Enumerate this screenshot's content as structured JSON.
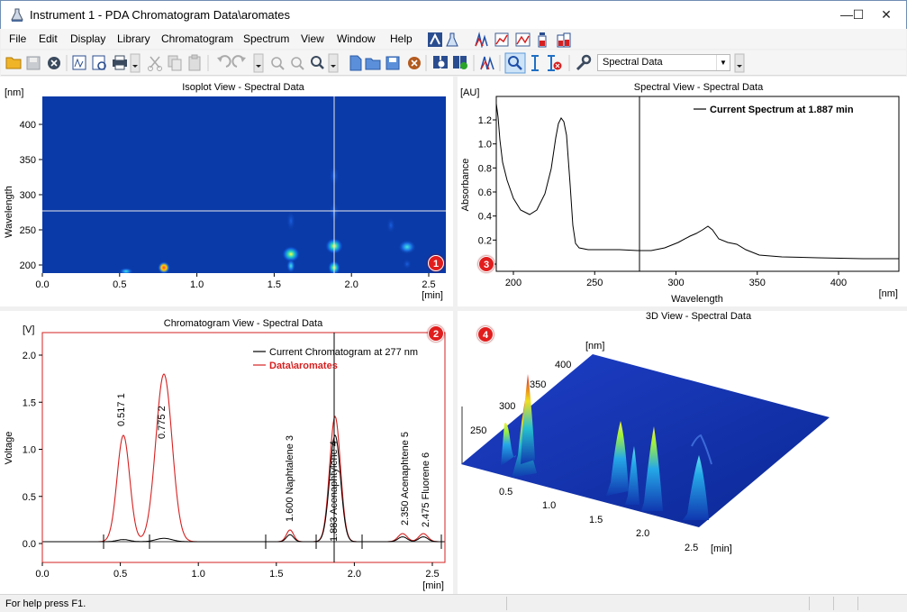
{
  "window": {
    "title": "Instrument 1 - PDA Chromatogram  Data\\aromates",
    "minimize": "—",
    "maximize": "☐",
    "close": "✕"
  },
  "menu": [
    "File",
    "Edit",
    "Display",
    "Library",
    "Chromatogram",
    "Spectrum",
    "View",
    "Window",
    "Help"
  ],
  "toolbar": {
    "combo_value": "Spectral Data"
  },
  "isoplot": {
    "title": "Isoplot View - Spectral Data",
    "y_unit": "[nm]",
    "y_label": "Wavelength",
    "x_unit": "[min]",
    "x_ticks": [
      "0.0",
      "0.5",
      "1.0",
      "1.5",
      "2.0",
      "2.5"
    ],
    "y_ticks": [
      "400",
      "350",
      "300",
      "250",
      "200"
    ],
    "badge": "1"
  },
  "spectral": {
    "title": "Spectral View - Spectral Data",
    "y_unit": "[AU]",
    "y_label": "Absorbance",
    "x_label": "Wavelength",
    "x_unit": "[nm]",
    "legend": "Current Spectrum at 1.887 min",
    "x_ticks": [
      "200",
      "250",
      "300",
      "350",
      "400"
    ],
    "y_ticks": [
      "1.2",
      "1.0",
      "0.8",
      "0.6",
      "0.4",
      "0.2",
      "0.0"
    ],
    "badge": "3"
  },
  "chromatogram": {
    "title": "Chromatogram View - Spectral Data",
    "y_unit": "[V]",
    "y_label": "Voltage",
    "x_unit": "[min]",
    "legend_current": "Current Chromatogram at 277 nm",
    "legend_data": "Data\\aromates",
    "x_ticks": [
      "0.0",
      "0.5",
      "1.0",
      "1.5",
      "2.0",
      "2.5"
    ],
    "y_ticks": [
      "2.0",
      "1.5",
      "1.0",
      "0.5",
      "0.0"
    ],
    "peaks": [
      "0.517   1",
      "0.775   2",
      "1.600 Naphtalene   3",
      "1.883 Acenaphtylene   4",
      "2.350 Acenaphtene   5",
      "2.475 Fluorene   6"
    ],
    "badge": "2"
  },
  "view3d": {
    "title": "3D View - Spectral Data",
    "nm_unit": "[nm]",
    "min_unit": "[min]",
    "nm_ticks": [
      "400",
      "350",
      "300",
      "250"
    ],
    "min_ticks": [
      "0.5",
      "1.0",
      "1.5",
      "2.0",
      "2.5"
    ],
    "badge": "4"
  },
  "status": {
    "text": "For help press F1."
  }
}
